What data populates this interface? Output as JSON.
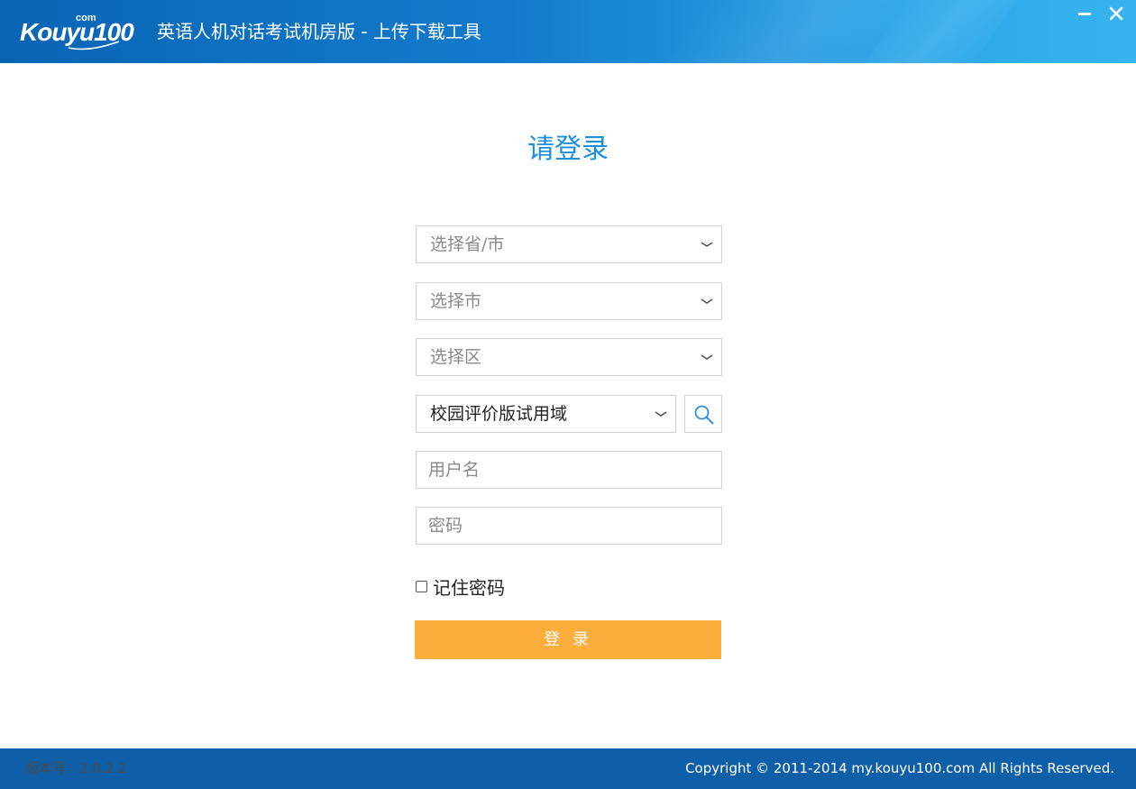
{
  "header": {
    "logo_text": "Kouyu",
    "logo_com": "com",
    "logo_number": "100",
    "title": "英语人机对话考试机房版 - 上传下载工具",
    "minimize_label": "−",
    "close_label": "✕",
    "colors": {
      "bar_start": "#0a64b4",
      "bar_end": "#37b4f0"
    }
  },
  "form": {
    "heading": "请登录",
    "province_select": {
      "value": "选择省/市",
      "icon": "chevron-down-icon"
    },
    "city_select": {
      "value": "选择市",
      "icon": "chevron-down-icon"
    },
    "district_select": {
      "value": "选择区",
      "icon": "chevron-down-icon"
    },
    "school_select": {
      "value": "校园评价版试用域",
      "icon": "chevron-down-icon"
    },
    "search_icon": "search-icon",
    "username": {
      "placeholder": "用户名"
    },
    "password": {
      "placeholder": "密码"
    },
    "remember": {
      "label": "记住密码",
      "checked": false
    },
    "login_button": "登 录",
    "colors": {
      "heading": "#1b8fdc",
      "button": "#fbae3c"
    }
  },
  "footer": {
    "version": "版本号：2.0.2.2",
    "copyright": "Copyright © 2011-2014 my.kouyu100.com All Rights Reserved.",
    "color": "#0f5ea8"
  }
}
